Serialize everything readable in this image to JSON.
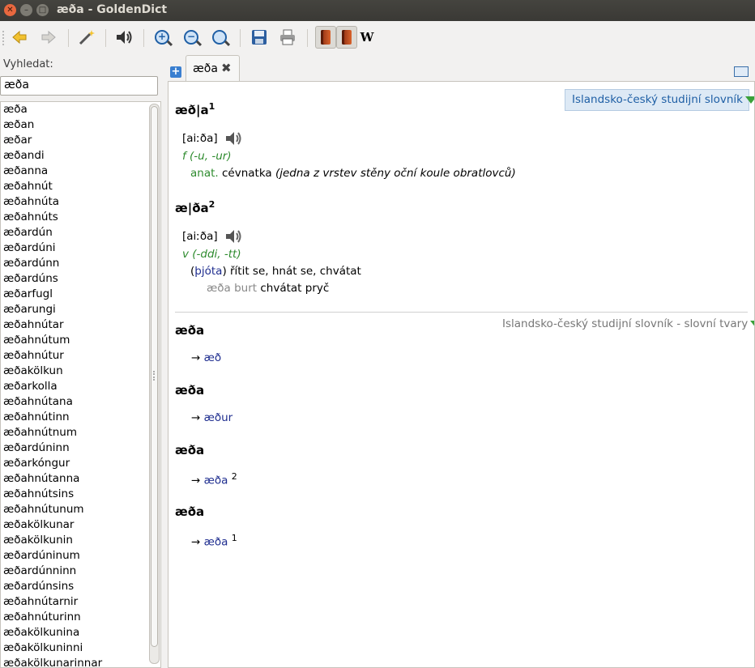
{
  "window": {
    "title": "æða - GoldenDict"
  },
  "toolbar": {
    "icons": [
      "back-icon",
      "forward-icon",
      "scan-wand-icon",
      "speaker-icon",
      "zoom-in-icon",
      "zoom-out-icon",
      "zoom-reset-icon",
      "save-icon",
      "print-icon",
      "dictionary-book-icon",
      "dictionary-book-icon",
      "wikipedia-icon"
    ],
    "wikipedia_glyph": "W"
  },
  "sidebar": {
    "label": "Vyhledat:",
    "search_value": "æða",
    "words": [
      "æða",
      "æðan",
      "æðar",
      "æðandi",
      "æðanna",
      "æðahnút",
      "æðahnúta",
      "æðahnúts",
      "æðardúni",
      "æðardúnn",
      "æðardúns",
      "æðarfugl",
      "æðarungi",
      "æðahnútar",
      "æðahnútum",
      "æðahnútur",
      "æðakölkun",
      "æðarkolla",
      "æðahnútana",
      "æðahnútinn",
      "æðahnútnum",
      "æðardúninn",
      "æðarkóngur",
      "æðahnútanna",
      "æðahnútsins",
      "æðahnútunum",
      "æðakölkunar",
      "æðakölkunin",
      "æðardúninum",
      "æðardúnninn",
      "æðardúnsins",
      "æðahnútarnir",
      "æðahnúturinn",
      "æðakölkunina",
      "æðakölkuninni",
      "æðakölkunarinnar"
    ],
    "list_first_extra": "æðardún"
  },
  "tabs": [
    {
      "label": "æða",
      "close_glyph": "✖"
    }
  ],
  "article": {
    "dict1_name": "Islandsko-český studijní slovník",
    "entry1": {
      "headword": "æð|a",
      "sup": "1",
      "pron": "[aiːða]",
      "gram": "f (-u, -ur)",
      "domain": "anat.",
      "meaning": "cévnatka",
      "note": "(jedna z vrstev stěny oční koule obratlovců)"
    },
    "entry2": {
      "headword": "æ|ða",
      "sup": "2",
      "pron": "[aiːða]",
      "gram": "v (-ddi, -tt)",
      "subject": "þjóta",
      "meaning": "řítit se, hnát se, chvátat",
      "example_is": "æða burt",
      "example_cs": "chvátat pryč"
    },
    "dict2_name": "Islandsko-český studijní slovník - slovní tvary",
    "forms": [
      {
        "headword": "æða",
        "arrow": "→",
        "link": "æð",
        "sup": ""
      },
      {
        "headword": "æða",
        "arrow": "→",
        "link": "æður",
        "sup": ""
      },
      {
        "headword": "æða",
        "arrow": "→",
        "link": "æða",
        "sup": "2"
      },
      {
        "headword": "æða",
        "arrow": "→",
        "link": "æða",
        "sup": "1"
      }
    ]
  }
}
